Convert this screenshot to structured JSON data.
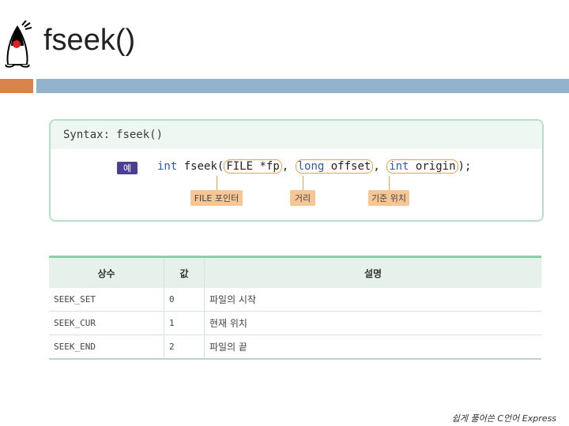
{
  "header": {
    "title": "fseek()"
  },
  "syntax": {
    "label": "Syntax:",
    "function": "fseek()",
    "example_badge": "예",
    "code": {
      "ret_type": "int",
      "name": "fseek(",
      "p1": "FILE *fp",
      "sep1": ", ",
      "p2_type": "long",
      "p2_name": " offset",
      "sep2": ", ",
      "p3_type": "int",
      "p3_name": " origin",
      "end": ");"
    },
    "labels": [
      "FILE 포인터",
      "거리",
      "기준 위치"
    ]
  },
  "table": {
    "headers": [
      "상수",
      "값",
      "설명"
    ],
    "rows": [
      [
        "SEEK_SET",
        "0",
        "파일의 시작"
      ],
      [
        "SEEK_CUR",
        "1",
        "현재 위치"
      ],
      [
        "SEEK_END",
        "2",
        "파일의 끝"
      ]
    ]
  },
  "footer": {
    "text": "쉽게 풀어쓴 C언어 Express"
  },
  "colors": {
    "accent_orange": "#d9834d",
    "accent_blue": "#92b3cc",
    "table_header_bg": "#e6f1ec"
  }
}
